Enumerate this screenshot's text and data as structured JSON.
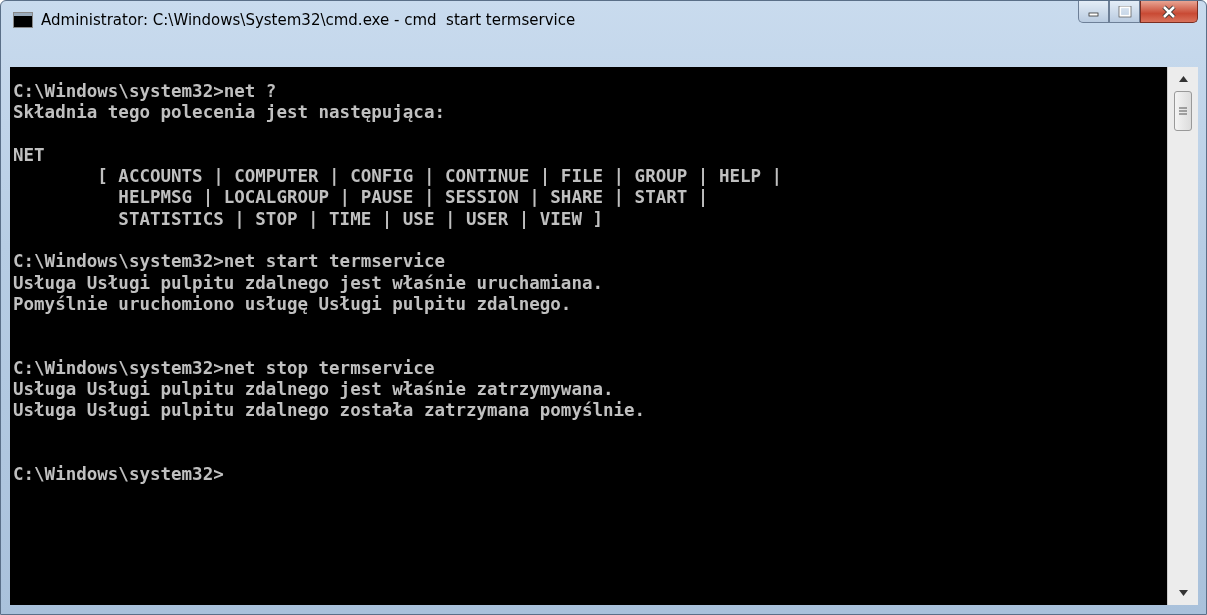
{
  "window": {
    "title": "Administrator: C:\\Windows\\System32\\cmd.exe - cmd  start termservice"
  },
  "console": {
    "lines": [
      {
        "kind": "text",
        "text": "C:\\Windows\\system32>net ?"
      },
      {
        "kind": "text",
        "text": "Składnia tego polecenia jest następująca:"
      },
      {
        "kind": "blank"
      },
      {
        "kind": "text",
        "text": "NET"
      },
      {
        "kind": "text",
        "text": "        [ ACCOUNTS | COMPUTER | CONFIG | CONTINUE | FILE | GROUP | HELP |"
      },
      {
        "kind": "text",
        "text": "          HELPMSG | LOCALGROUP | PAUSE | SESSION | SHARE | START |"
      },
      {
        "kind": "text",
        "text": "          STATISTICS | STOP | TIME | USE | USER | VIEW ]"
      },
      {
        "kind": "blank"
      },
      {
        "kind": "text",
        "text": "C:\\Windows\\system32>net start termservice"
      },
      {
        "kind": "text",
        "text": "Usługa Usługi pulpitu zdalnego jest właśnie uruchamiana."
      },
      {
        "kind": "text",
        "text": "Pomyślnie uruchomiono usługę Usługi pulpitu zdalnego."
      },
      {
        "kind": "blank"
      },
      {
        "kind": "blank"
      },
      {
        "kind": "text",
        "text": "C:\\Windows\\system32>net stop termservice"
      },
      {
        "kind": "text",
        "text": "Usługa Usługi pulpitu zdalnego jest właśnie zatrzymywana."
      },
      {
        "kind": "text",
        "text": "Usługa Usługi pulpitu zdalnego została zatrzymana pomyślnie."
      },
      {
        "kind": "blank"
      },
      {
        "kind": "blank"
      },
      {
        "kind": "text",
        "text": "C:\\Windows\\system32>"
      }
    ]
  }
}
